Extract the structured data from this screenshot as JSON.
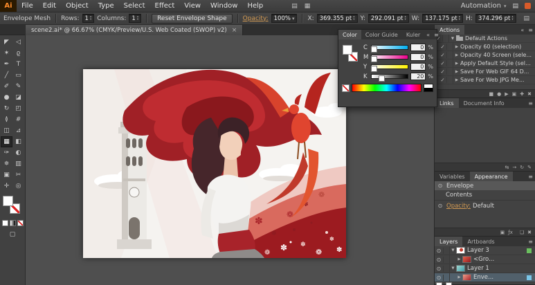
{
  "menu_bar": {
    "app_icon": "Ai",
    "items": [
      "File",
      "Edit",
      "Object",
      "Type",
      "Select",
      "Effect",
      "View",
      "Window",
      "Help"
    ],
    "workspace_label": "Automation"
  },
  "control_bar": {
    "tool_label": "Envelope Mesh",
    "rows_label": "Rows:",
    "rows_value": "1",
    "columns_label": "Columns:",
    "columns_value": "1",
    "reset_button_label": "Reset Envelope Shape",
    "opacity_label": "Opacity:",
    "opacity_value": "100%",
    "x_label": "X:",
    "x_value": "369.355 pt",
    "y_label": "Y:",
    "y_value": "292.091 pt",
    "w_label": "W:",
    "w_value": "137.175 pt",
    "h_label": "H:",
    "h_value": "374.296 pt"
  },
  "document_tab": {
    "title": "scene2.ai* @ 66.67% (CMYK/Preview/U.S. Web Coated (SWOP) v2)"
  },
  "color_panel": {
    "tabs": [
      "Color",
      "Color Guide",
      "Kuler"
    ],
    "channels": [
      {
        "label": "C",
        "value": "0"
      },
      {
        "label": "M",
        "value": "0"
      },
      {
        "label": "Y",
        "value": "0"
      },
      {
        "label": "K",
        "value": "20"
      }
    ],
    "unit": "%"
  },
  "actions_panel": {
    "title": "Actions",
    "set_name": "Default Actions",
    "items": [
      "Opacity 60 (selection)",
      "Opacity 40 Screen (sele...",
      "Apply Default Style (sele...",
      "Save For Web GIF 64 D...",
      "Save For Web JPG Me..."
    ]
  },
  "links_panel": {
    "tabs": [
      "Links",
      "Document Info"
    ]
  },
  "appearance_panel": {
    "tabs": [
      "Variables",
      "Appearance"
    ],
    "rows": [
      {
        "label": "Envelope"
      },
      {
        "label": "Contents"
      }
    ],
    "opacity_label": "Opacity:",
    "opacity_value": "Default"
  },
  "layers_panel": {
    "tabs": [
      "Layers",
      "Artboards"
    ],
    "layers": [
      {
        "name": "Layer 3"
      },
      {
        "name": "<Gro..."
      },
      {
        "name": "Layer 1"
      },
      {
        "name": "Enve..."
      }
    ]
  },
  "tools": [
    {
      "name": "selection",
      "icon": "◤"
    },
    {
      "name": "direct-selection",
      "icon": "◁"
    },
    {
      "name": "magic-wand",
      "icon": "✶"
    },
    {
      "name": "lasso",
      "icon": "ϱ"
    },
    {
      "name": "pen",
      "icon": "✒"
    },
    {
      "name": "type",
      "icon": "T"
    },
    {
      "name": "line-segment",
      "icon": "╱"
    },
    {
      "name": "rectangle",
      "icon": "▭"
    },
    {
      "name": "paintbrush",
      "icon": "✐"
    },
    {
      "name": "pencil",
      "icon": "✎"
    },
    {
      "name": "blob-brush",
      "icon": "●"
    },
    {
      "name": "eraser",
      "icon": "◪"
    },
    {
      "name": "rotate",
      "icon": "↻"
    },
    {
      "name": "scale",
      "icon": "◰"
    },
    {
      "name": "width",
      "icon": "≬"
    },
    {
      "name": "free-transform",
      "icon": "#"
    },
    {
      "name": "shape-builder",
      "icon": "◫"
    },
    {
      "name": "perspective-grid",
      "icon": "⊿"
    },
    {
      "name": "mesh",
      "icon": "▦"
    },
    {
      "name": "gradient",
      "icon": "◧"
    },
    {
      "name": "eyedropper",
      "icon": "✑"
    },
    {
      "name": "blend",
      "icon": "◐"
    },
    {
      "name": "symbol-sprayer",
      "icon": "✵"
    },
    {
      "name": "column-graph",
      "icon": "▥"
    },
    {
      "name": "artboard",
      "icon": "▣"
    },
    {
      "name": "slice",
      "icon": "✂"
    },
    {
      "name": "hand",
      "icon": "✛"
    },
    {
      "name": "zoom",
      "icon": "◎"
    }
  ],
  "icons": {
    "check": "✓",
    "panel_menu": "≡",
    "close": "×",
    "chevron_down": "▾",
    "dock_collapse": "«",
    "expanded": "▼",
    "collapsed": "▶",
    "eye": "⊙",
    "spin_up": "▴",
    "spin_down": "▾",
    "stop": "■",
    "record": "●",
    "play": "▶",
    "new_set": "▣",
    "new_action": "✚",
    "delete": "✖",
    "relink": "⇆",
    "go_to_link": "→",
    "update_link": "↻",
    "edit_original": "✎",
    "fx": "ƒx",
    "duplicate": "❏",
    "arrange": "▤",
    "grid": "▦",
    "panel_dock": "▤"
  },
  "colors": {
    "accent_link": "#d29a53",
    "app_logo_bg": "#2b1a00",
    "app_logo_text": "#ff8d2a",
    "layer_chip_green": "#6abf5e",
    "layer_chip_blue": "#7ac6e8"
  }
}
